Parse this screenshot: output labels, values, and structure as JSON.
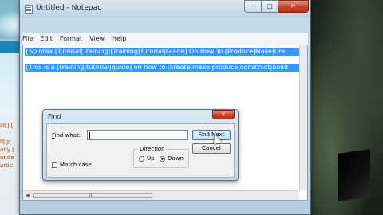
{
  "background": {
    "left_text_lines": [
      "ill[] [",
      "ll[gr",
      "any [",
      "unde",
      "artic"
    ]
  },
  "notepad": {
    "title": "Untitled - Notepad",
    "controls": {
      "minimize": "–",
      "maximize": "□",
      "close": "✕"
    },
    "menu": [
      "File",
      "Edit",
      "Format",
      "View",
      "Help"
    ],
    "lines": [
      "{Spintax [Tutorial|Training|[Training|Tutorial|Guide] On How To [Produce|Make|Cre",
      "{This is a [training|tutorial|guide] on how to [create|make|produce|construct|build"
    ],
    "scroll_grip": "III"
  },
  "find_dialog": {
    "title": "Find",
    "close": "✕",
    "find_what_label": "Find what:",
    "find_what_value": "",
    "find_next": "Find Next",
    "cancel": "Cancel",
    "direction_label": "Direction",
    "up_label": "Up",
    "down_label": "Down",
    "direction_selected": "Down",
    "match_case_label": "Match case",
    "match_case_checked": false
  }
}
